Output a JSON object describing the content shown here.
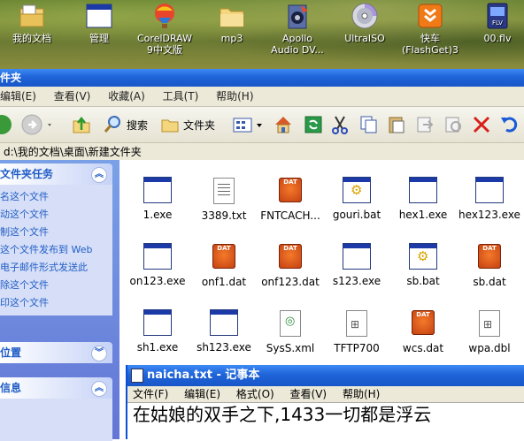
{
  "desktop": {
    "icons": [
      {
        "label": "我的文档",
        "icon": "my-documents-icon"
      },
      {
        "label": "管理",
        "icon": "app-window-icon"
      },
      {
        "label": "CorelDRAW 9中文版",
        "label1": "CorelDRAW",
        "label2": "9中文版",
        "icon": "balloon-icon"
      },
      {
        "label": "mp3",
        "icon": "folder-icon"
      },
      {
        "label": "Apollo Audio DV...",
        "label1": "Apollo",
        "label2": "Audio DV...",
        "icon": "apollo-icon"
      },
      {
        "label": "UltraISO",
        "icon": "disc-icon"
      },
      {
        "label": "快车 (FlashGet)3",
        "label1": "快车",
        "label2": "(FlashGet)3",
        "icon": "flashget-icon"
      },
      {
        "label": "00.flv",
        "icon": "flv-file-icon"
      }
    ]
  },
  "explorer": {
    "title": "件夹",
    "menu": [
      "编辑(E)",
      "查看(V)",
      "收藏(A)",
      "工具(T)",
      "帮助(H)"
    ],
    "toolbar": {
      "search": "搜索",
      "folders": "文件夹"
    },
    "address": "d:\\我的文档\\桌面\\新建文件夹",
    "tasks_panel": {
      "title": "文件夹任务",
      "items": [
        "名这个文件",
        "动这个文件",
        "制这个文件",
        "这个文件发布到 Web",
        "电子邮件形式发送此",
        "除这个文件",
        "印这个文件"
      ]
    },
    "other_panel": {
      "title": "位置"
    },
    "details_panel": {
      "title": "信息"
    },
    "files": [
      {
        "name": "1.exe",
        "type": "exe"
      },
      {
        "name": "3389.txt",
        "type": "txt"
      },
      {
        "name": "FNTCACH...",
        "type": "dat"
      },
      {
        "name": "gouri.bat",
        "type": "bat"
      },
      {
        "name": "hex1.exe",
        "type": "exe"
      },
      {
        "name": "hex123.exe",
        "type": "exe"
      },
      {
        "name": "on123.exe",
        "type": "exe"
      },
      {
        "name": "onf1.dat",
        "type": "dat"
      },
      {
        "name": "onf123.dat",
        "type": "dat"
      },
      {
        "name": "s123.exe",
        "type": "exe"
      },
      {
        "name": "sb.bat",
        "type": "bat"
      },
      {
        "name": "sb.dat",
        "type": "dat"
      },
      {
        "name": "sh1.exe",
        "type": "exe"
      },
      {
        "name": "sh123.exe",
        "type": "exe"
      },
      {
        "name": "SysS.xml",
        "type": "xml"
      },
      {
        "name": "TFTP700",
        "type": "dbl"
      },
      {
        "name": "wcs.dat",
        "type": "dat"
      },
      {
        "name": "wpa.dbl",
        "type": "dbl"
      }
    ]
  },
  "notepad": {
    "title": "naicha.txt - 记事本",
    "menu": [
      "文件(F)",
      "编辑(E)",
      "格式(O)",
      "查看(V)",
      "帮助(H)"
    ],
    "content": "在姑娘的双手之下,1433一切都是浮云"
  },
  "colors": {
    "titlebar": "#1f64d8",
    "taskpane": "#6375d6",
    "dat": "#e0561c"
  }
}
